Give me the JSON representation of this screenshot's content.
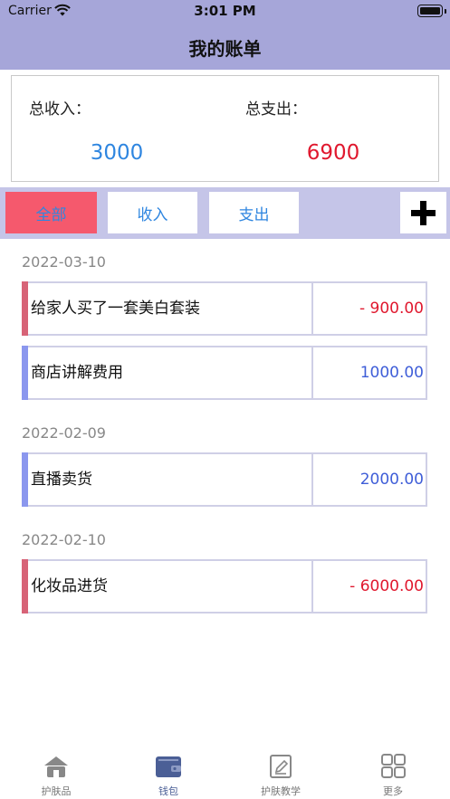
{
  "status_bar": {
    "carrier": "Carrier",
    "time": "3:01 PM"
  },
  "nav": {
    "title": "我的账单"
  },
  "summary": {
    "income_label": "总收入：",
    "income_value": "3000",
    "expense_label": "总支出：",
    "expense_value": "6900"
  },
  "filters": [
    {
      "label": "全部",
      "active": true
    },
    {
      "label": "收入",
      "active": false
    },
    {
      "label": "支出",
      "active": false
    }
  ],
  "add_icon": "plus-icon",
  "groups": [
    {
      "date": "2022-03-10",
      "items": [
        {
          "name": "给家人买了一套美白套装",
          "amount": "- 900.00",
          "type": "expense"
        },
        {
          "name": "商店讲解费用",
          "amount": "1000.00",
          "type": "income"
        }
      ]
    },
    {
      "date": "2022-02-09",
      "items": [
        {
          "name": "直播卖货",
          "amount": "2000.00",
          "type": "income"
        }
      ]
    },
    {
      "date": "2022-02-10",
      "items": [
        {
          "name": "化妆品进货",
          "amount": "- 6000.00",
          "type": "expense"
        }
      ]
    }
  ],
  "tabs": [
    {
      "label": "护肤品",
      "icon": "home-icon",
      "active": false
    },
    {
      "label": "钱包",
      "icon": "wallet-icon",
      "active": true
    },
    {
      "label": "护肤教学",
      "icon": "edit-icon",
      "active": false
    },
    {
      "label": "更多",
      "icon": "grid-icon",
      "active": false
    }
  ],
  "colors": {
    "nav_bg": "#a6a6d9",
    "filter_bar_bg": "#c5c5e8",
    "active_filter": "#f5596d",
    "income_blue": "#2f86e0",
    "expense_red": "#e0182e",
    "expense_marker": "#d76377",
    "income_marker": "#8b97ee"
  }
}
